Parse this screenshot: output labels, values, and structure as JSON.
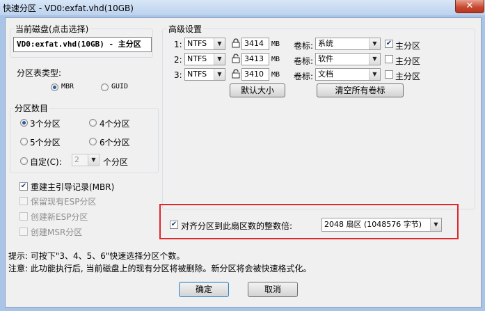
{
  "window": {
    "title": "快速分区 - VD0:exfat.vhd(10GB)",
    "close_glyph": "✕"
  },
  "current_disk": {
    "label": "当前磁盘(点击选择)",
    "value": "VD0:exfat.vhd(10GB) - 主分区"
  },
  "partition_table": {
    "label": "分区表类型:",
    "options": [
      "MBR",
      "GUID"
    ],
    "selected": "MBR"
  },
  "partition_count": {
    "label": "分区数目",
    "options": [
      "3个分区",
      "4个分区",
      "5个分区",
      "6个分区"
    ],
    "custom_label": "自定(C):",
    "custom_value": "2",
    "custom_suffix": "个分区",
    "selected": "3个分区"
  },
  "options": {
    "rebuild_mbr": "重建主引导记录(MBR)",
    "keep_esp": "保留现有ESP分区",
    "create_esp": "创建新ESP分区",
    "create_msr": "创建MSR分区"
  },
  "advanced": {
    "label": "高级设置",
    "unit": "MB",
    "volume_label_text": "卷标:",
    "primary_text": "主分区",
    "rows": [
      {
        "index": "1:",
        "fs": "NTFS",
        "size": "3414",
        "locked": true,
        "volume": "系统",
        "primary": true
      },
      {
        "index": "2:",
        "fs": "NTFS",
        "size": "3413",
        "locked": false,
        "volume": "软件",
        "primary": false
      },
      {
        "index": "3:",
        "fs": "NTFS",
        "size": "3410",
        "locked": false,
        "volume": "文档",
        "primary": false
      }
    ],
    "default_size_button": "默认大小",
    "clear_labels_button": "清空所有卷标"
  },
  "align": {
    "label": "对齐分区到此扇区数的整数倍:",
    "checked": true,
    "value": "2048 扇区 (1048576 字节)"
  },
  "tips": {
    "line1": "提示: 可按下\"3、4、5、6\"快速选择分区个数。",
    "line2": "注意: 此功能执行后, 当前磁盘上的现有分区将被删除。新分区将会被快速格式化。"
  },
  "buttons": {
    "ok": "确定",
    "cancel": "取消"
  },
  "colors": {
    "highlight_box": "#e0262b",
    "title_bg": "#bcd2ee",
    "dialog_bg": "#f0f0f0"
  }
}
